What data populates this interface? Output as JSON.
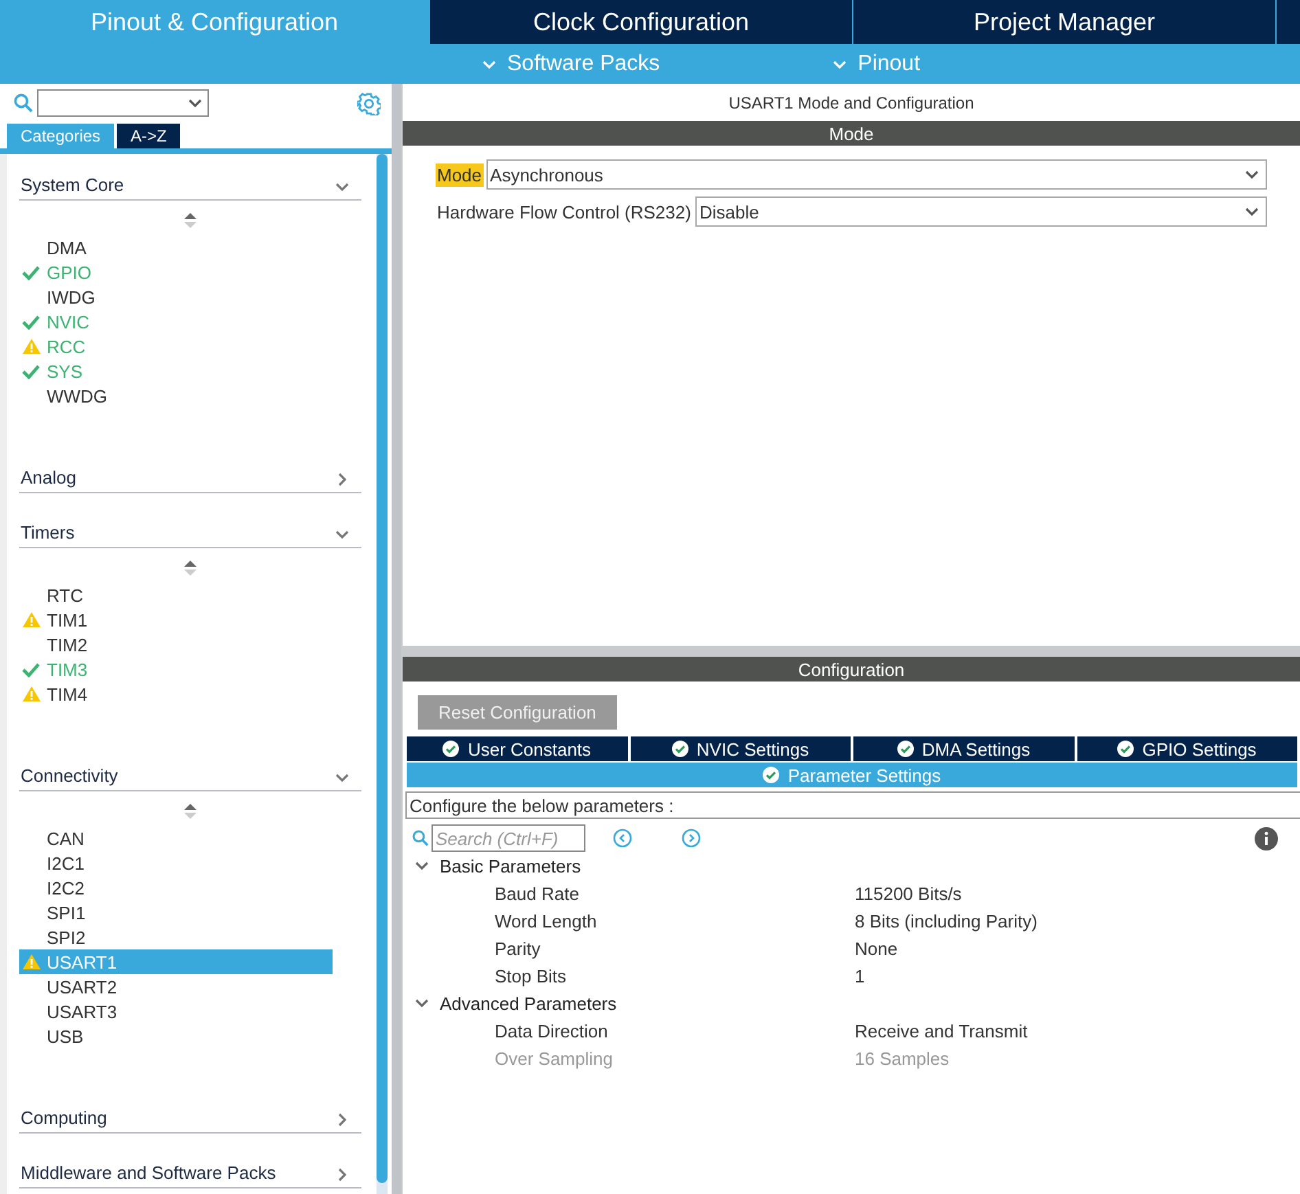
{
  "main_tabs": [
    {
      "label": "Pinout & Configuration",
      "selected": true
    },
    {
      "label": "Clock Configuration",
      "selected": false
    },
    {
      "label": "Project Manager",
      "selected": false
    }
  ],
  "sub_menu": [
    {
      "label": "Software Packs"
    },
    {
      "label": "Pinout"
    }
  ],
  "sidebar": {
    "view_tabs": [
      {
        "label": "Categories",
        "selected": true
      },
      {
        "label": "A->Z",
        "selected": false
      }
    ],
    "categories": [
      {
        "label": "System Core",
        "expanded": true,
        "items": [
          {
            "label": "DMA",
            "checked": false,
            "warning": false,
            "configured": false,
            "selected": false
          },
          {
            "label": "GPIO",
            "checked": true,
            "warning": false,
            "configured": true,
            "selected": false
          },
          {
            "label": "IWDG",
            "checked": false,
            "warning": false,
            "configured": false,
            "selected": false
          },
          {
            "label": "NVIC",
            "checked": true,
            "warning": false,
            "configured": true,
            "selected": false
          },
          {
            "label": "RCC",
            "checked": false,
            "warning": true,
            "configured": true,
            "selected": false
          },
          {
            "label": "SYS",
            "checked": true,
            "warning": false,
            "configured": true,
            "selected": false
          },
          {
            "label": "WWDG",
            "checked": false,
            "warning": false,
            "configured": false,
            "selected": false
          }
        ]
      },
      {
        "label": "Analog",
        "expanded": false
      },
      {
        "label": "Timers",
        "expanded": true,
        "items": [
          {
            "label": "RTC",
            "checked": false,
            "warning": false,
            "configured": false,
            "selected": false
          },
          {
            "label": "TIM1",
            "checked": false,
            "warning": true,
            "configured": false,
            "selected": false
          },
          {
            "label": "TIM2",
            "checked": false,
            "warning": false,
            "configured": false,
            "selected": false
          },
          {
            "label": "TIM3",
            "checked": true,
            "warning": false,
            "configured": true,
            "selected": false
          },
          {
            "label": "TIM4",
            "checked": false,
            "warning": true,
            "configured": false,
            "selected": false
          }
        ]
      },
      {
        "label": "Connectivity",
        "expanded": true,
        "items": [
          {
            "label": "CAN",
            "checked": false,
            "warning": false,
            "configured": false,
            "selected": false
          },
          {
            "label": "I2C1",
            "checked": false,
            "warning": false,
            "configured": false,
            "selected": false
          },
          {
            "label": "I2C2",
            "checked": false,
            "warning": false,
            "configured": false,
            "selected": false
          },
          {
            "label": "SPI1",
            "checked": false,
            "warning": false,
            "configured": false,
            "selected": false
          },
          {
            "label": "SPI2",
            "checked": false,
            "warning": false,
            "configured": false,
            "selected": false
          },
          {
            "label": "USART1",
            "checked": false,
            "warning": true,
            "configured": false,
            "selected": true
          },
          {
            "label": "USART2",
            "checked": false,
            "warning": false,
            "configured": false,
            "selected": false
          },
          {
            "label": "USART3",
            "checked": false,
            "warning": false,
            "configured": false,
            "selected": false
          },
          {
            "label": "USB",
            "checked": false,
            "warning": false,
            "configured": false,
            "selected": false
          }
        ]
      },
      {
        "label": "Computing",
        "expanded": false
      },
      {
        "label": "Middleware and Software Packs",
        "expanded": false
      }
    ]
  },
  "panel": {
    "title": "USART1 Mode and Configuration",
    "mode_header": "Mode",
    "mode_fields": [
      {
        "label": "Mode",
        "highlighted": true,
        "value": "Asynchronous"
      },
      {
        "label": "Hardware Flow Control (RS232)",
        "highlighted": false,
        "value": "Disable"
      }
    ],
    "config_header": "Configuration",
    "reset_button": {
      "label": "Reset Configuration",
      "disabled": true
    },
    "config_tabs": [
      {
        "label": "User Constants",
        "selected": false
      },
      {
        "label": "NVIC Settings",
        "selected": false
      },
      {
        "label": "DMA Settings",
        "selected": false
      },
      {
        "label": "GPIO Settings",
        "selected": false
      },
      {
        "label": "Parameter Settings",
        "selected": true
      }
    ],
    "hint": "Configure the below parameters :",
    "search": {
      "placeholder": "Search (Ctrl+F)"
    },
    "groups": [
      {
        "label": "Basic Parameters",
        "expanded": true,
        "params": [
          {
            "name": "Baud Rate",
            "value": "115200 Bits/s",
            "disabled": false
          },
          {
            "name": "Word Length",
            "value": "8 Bits (including Parity)",
            "disabled": false
          },
          {
            "name": "Parity",
            "value": "None",
            "disabled": false
          },
          {
            "name": "Stop Bits",
            "value": "1",
            "disabled": false
          }
        ]
      },
      {
        "label": "Advanced Parameters",
        "expanded": true,
        "params": [
          {
            "name": "Data Direction",
            "value": "Receive and Transmit",
            "disabled": false
          },
          {
            "name": "Over Sampling",
            "value": "16 Samples",
            "disabled": true
          }
        ]
      }
    ]
  }
}
